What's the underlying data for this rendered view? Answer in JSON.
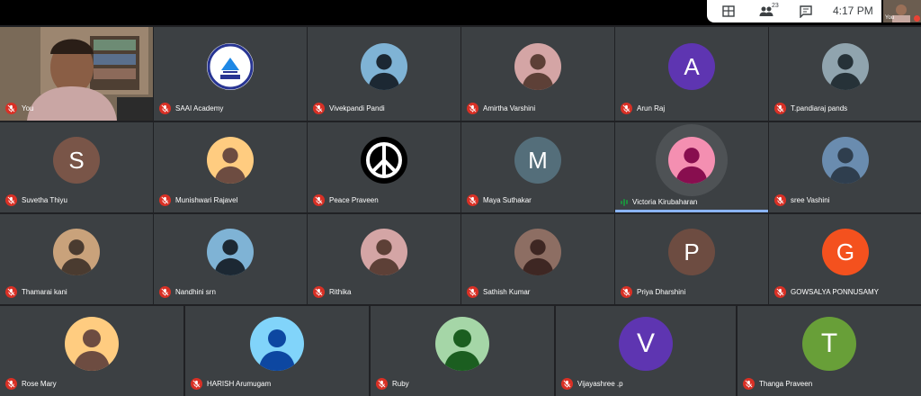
{
  "meeting": {
    "time": "4:17 PM",
    "participant_count": "23",
    "self_label": "You"
  },
  "colors": {
    "tile": "#3c4043",
    "background": "#202124",
    "muted_mic": "#d93025",
    "speaking": "#1e8e3e"
  },
  "toolbar": {
    "icons": [
      "meeting-details-icon",
      "people-icon",
      "chat-icon"
    ]
  },
  "tiles": [
    {
      "name": "You",
      "avatar": "camera-feed",
      "muted": true
    },
    {
      "name": "SAAI Academy",
      "avatar": "logo",
      "muted": true
    },
    {
      "name": "Vivekpandi Pandi",
      "avatar": "photo",
      "muted": true
    },
    {
      "name": "Amirtha Varshini",
      "avatar": "photo",
      "muted": true
    },
    {
      "name": "Arun Raj",
      "avatar": "letter",
      "letter": "A",
      "color": "#5e35b1",
      "muted": true
    },
    {
      "name": "T.pandiaraj pands",
      "avatar": "photo",
      "muted": true
    },
    {
      "name": "Suvetha Thiyu",
      "avatar": "letter",
      "letter": "S",
      "color": "#795548",
      "muted": true
    },
    {
      "name": "Munishwari Rajavel",
      "avatar": "photo",
      "muted": true
    },
    {
      "name": "Peace Praveen",
      "avatar": "peace-symbol",
      "muted": true
    },
    {
      "name": "Maya Suthakar",
      "avatar": "letter",
      "letter": "M",
      "color": "#546e7a",
      "muted": true
    },
    {
      "name": "Victoria Kirubaharan",
      "avatar": "photo",
      "muted": false,
      "speaking": true
    },
    {
      "name": "sree Vashini",
      "avatar": "photo",
      "muted": true
    },
    {
      "name": "Thamarai kani",
      "avatar": "photo",
      "muted": true
    },
    {
      "name": "Nandhini srn",
      "avatar": "photo",
      "muted": true
    },
    {
      "name": "Rithika",
      "avatar": "photo",
      "muted": true
    },
    {
      "name": "Sathish Kumar",
      "avatar": "photo",
      "muted": true
    },
    {
      "name": "Priya Dharshini",
      "avatar": "letter",
      "letter": "P",
      "color": "#6d4c41",
      "muted": true
    },
    {
      "name": "GOWSALYA PONNUSAMY",
      "avatar": "letter",
      "letter": "G",
      "color": "#f4511e",
      "muted": true
    },
    {
      "name": "Rose Mary",
      "avatar": "photo",
      "muted": true
    },
    {
      "name": "HARISH Arumugam",
      "avatar": "photo",
      "muted": true
    },
    {
      "name": "Ruby",
      "avatar": "photo",
      "muted": true
    },
    {
      "name": "Vijayashree .p",
      "avatar": "letter",
      "letter": "V",
      "color": "#5e35b1",
      "muted": true
    },
    {
      "name": "Thanga Praveen",
      "avatar": "letter",
      "letter": "T",
      "color": "#689f38",
      "muted": true
    }
  ]
}
